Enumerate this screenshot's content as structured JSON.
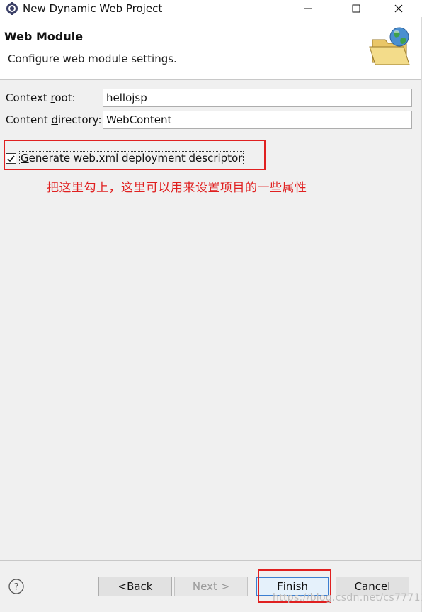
{
  "window": {
    "title": "New Dynamic Web Project",
    "icon": "eclipse-gear-icon"
  },
  "banner": {
    "title": "Web Module",
    "description": "Configure web module settings.",
    "icon": "web-folder-globe-icon"
  },
  "form": {
    "context_root": {
      "label_pre": "Context ",
      "label_mnemonic": "r",
      "label_post": "oot:",
      "value": "hellojsp"
    },
    "content_directory": {
      "label_pre": "Content ",
      "label_mnemonic": "d",
      "label_post": "irectory:",
      "value": "WebContent"
    },
    "generate_xml": {
      "label_mnemonic": "G",
      "label_post": "enerate web.xml deployment descriptor",
      "checked": true
    }
  },
  "annotation": {
    "text": "把这里勾上，这里可以用来设置项目的一些属性",
    "color": "#e02020"
  },
  "buttons": {
    "help_icon": "help-icon",
    "back": {
      "pre": "< ",
      "mnemonic": "B",
      "post": "ack"
    },
    "next": {
      "mnemonic": "N",
      "post": "ext >"
    },
    "finish": {
      "mnemonic": "F",
      "post": "inish"
    },
    "cancel": "Cancel"
  },
  "watermark": "https://blog.csdn.net/cs77711"
}
